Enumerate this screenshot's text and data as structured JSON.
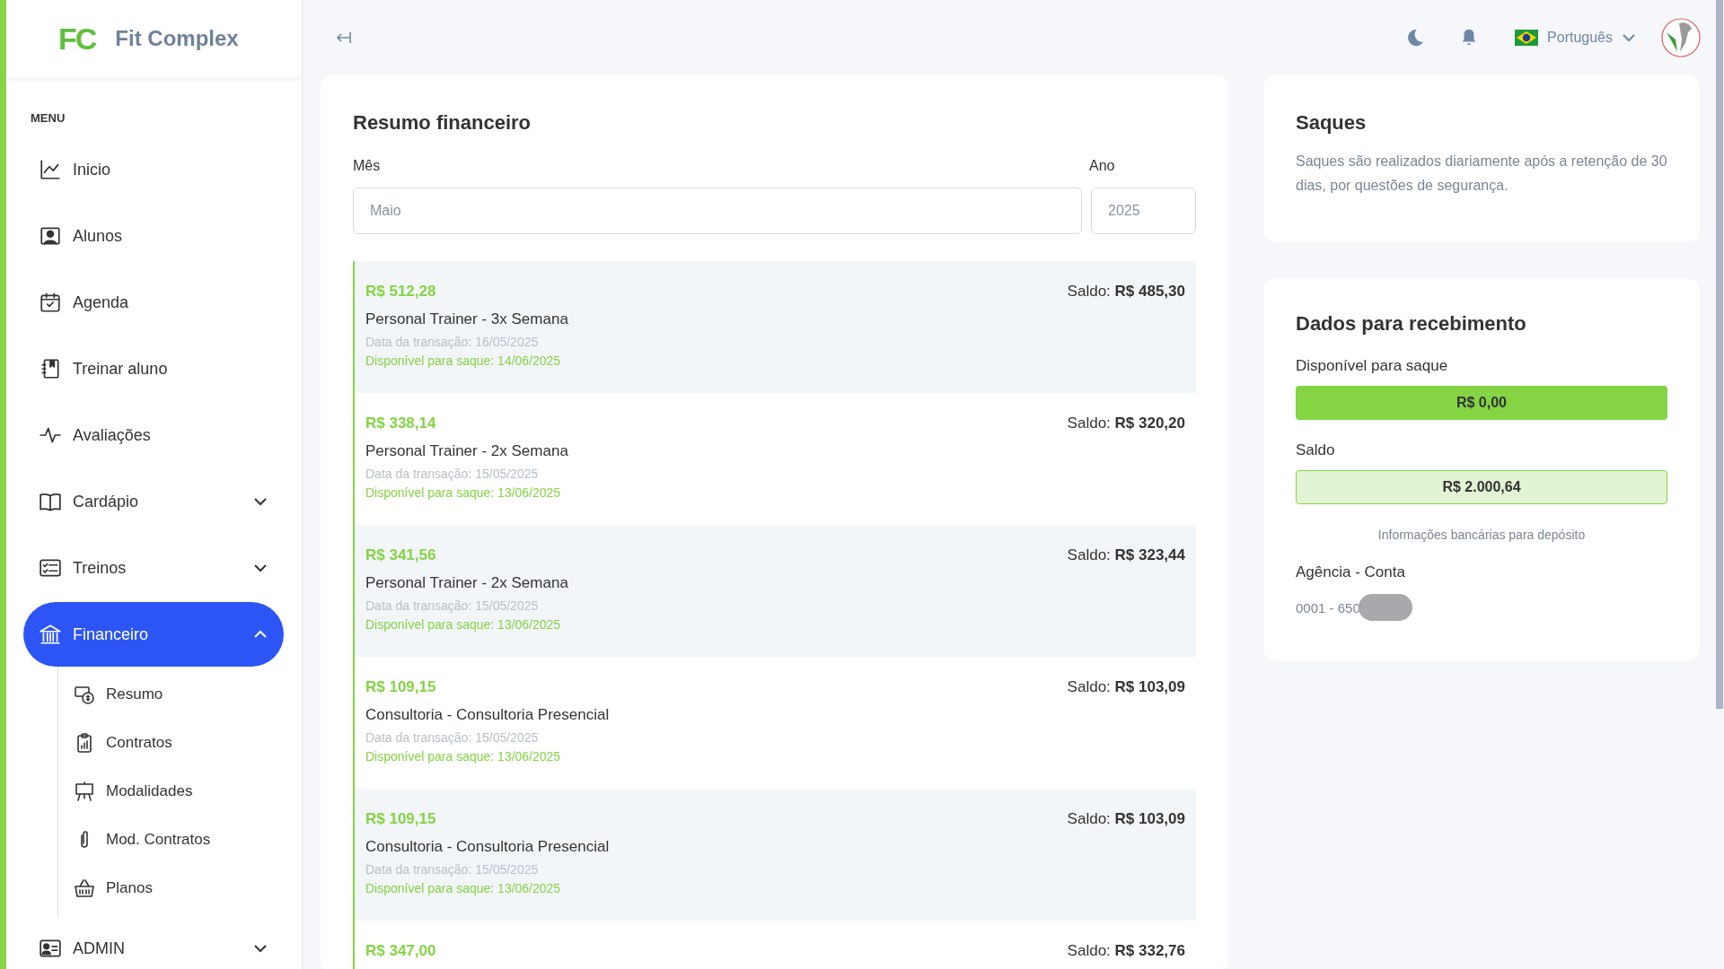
{
  "app": {
    "logo": "FC",
    "name": "Fit Complex"
  },
  "sidebar": {
    "heading": "MENU",
    "items": [
      {
        "label": "Inicio",
        "kind": "link",
        "selected": false
      },
      {
        "label": "Alunos",
        "kind": "link",
        "selected": false
      },
      {
        "label": "Agenda",
        "kind": "link",
        "selected": false
      },
      {
        "label": "Treinar aluno",
        "kind": "link",
        "selected": false
      },
      {
        "label": "Avaliações",
        "kind": "link",
        "selected": false
      },
      {
        "label": "Cardápio",
        "kind": "group",
        "selected": false,
        "expanded": false
      },
      {
        "label": "Treinos",
        "kind": "group",
        "selected": false,
        "expanded": false
      },
      {
        "label": "Financeiro",
        "kind": "group",
        "selected": true,
        "expanded": true,
        "children": [
          {
            "label": "Resumo",
            "selected": false
          },
          {
            "label": "Contratos",
            "selected": false
          },
          {
            "label": "Modalidades",
            "selected": false
          },
          {
            "label": "Mod. Contratos",
            "selected": false
          },
          {
            "label": "Planos",
            "selected": false
          }
        ]
      },
      {
        "label": "ADMIN",
        "kind": "group",
        "selected": false,
        "expanded": false
      }
    ]
  },
  "topbar": {
    "language": "Português"
  },
  "summary": {
    "title": "Resumo financeiro",
    "month_label": "Mês",
    "month_value": "Maio",
    "year_label": "Ano",
    "year_value": "2025",
    "transactions": [
      {
        "amount": "R$ 512,28",
        "balance": "Saldo: **R$ 485,30**",
        "description": "Personal Trainer - 3x Semana",
        "date": "Data da transação: 16/05/2025",
        "available": "Disponível para saque: 14/06/2025"
      },
      {
        "amount": "R$ 338,14",
        "balance": "Saldo: **R$ 320,20**",
        "description": "Personal Trainer - 2x Semana",
        "date": "Data da transação: 15/05/2025",
        "available": "Disponível para saque: 13/06/2025"
      },
      {
        "amount": "R$ 341,56",
        "balance": "Saldo: **R$ 323,44**",
        "description": "Personal Trainer - 2x Semana",
        "date": "Data da transação: 15/05/2025",
        "available": "Disponível para saque: 13/06/2025"
      },
      {
        "amount": "R$ 109,15",
        "balance": "Saldo: **R$ 103,09**",
        "description": "Consultoria - Consultoria Presencial",
        "date": "Data da transação: 15/05/2025",
        "available": "Disponível para saque: 13/06/2025"
      },
      {
        "amount": "R$ 109,15",
        "balance": "Saldo: **R$ 103,09**",
        "description": "Consultoria - Consultoria Presencial",
        "date": "Data da transação: 15/05/2025",
        "available": "Disponível para saque: 13/06/2025"
      },
      {
        "amount": "R$ 347,00",
        "balance": "Saldo: **R$ 332,76**"
      }
    ]
  },
  "withdrawals": {
    "title": "Saques",
    "text": "Saques são realizados diariamente após a retenção de 30 dias, por questões de segurança."
  },
  "receiving": {
    "title": "Dados para recebimento",
    "available_label": "Disponível para saque",
    "available_value": "R$ 0,00",
    "balance_label": "Saldo",
    "balance_value": "R$ 2.000,64",
    "bank_info": "Informações bancárias para depósito",
    "account_label": "Agência - Conta",
    "account_value": "0001 - 650",
    "masked": true
  }
}
